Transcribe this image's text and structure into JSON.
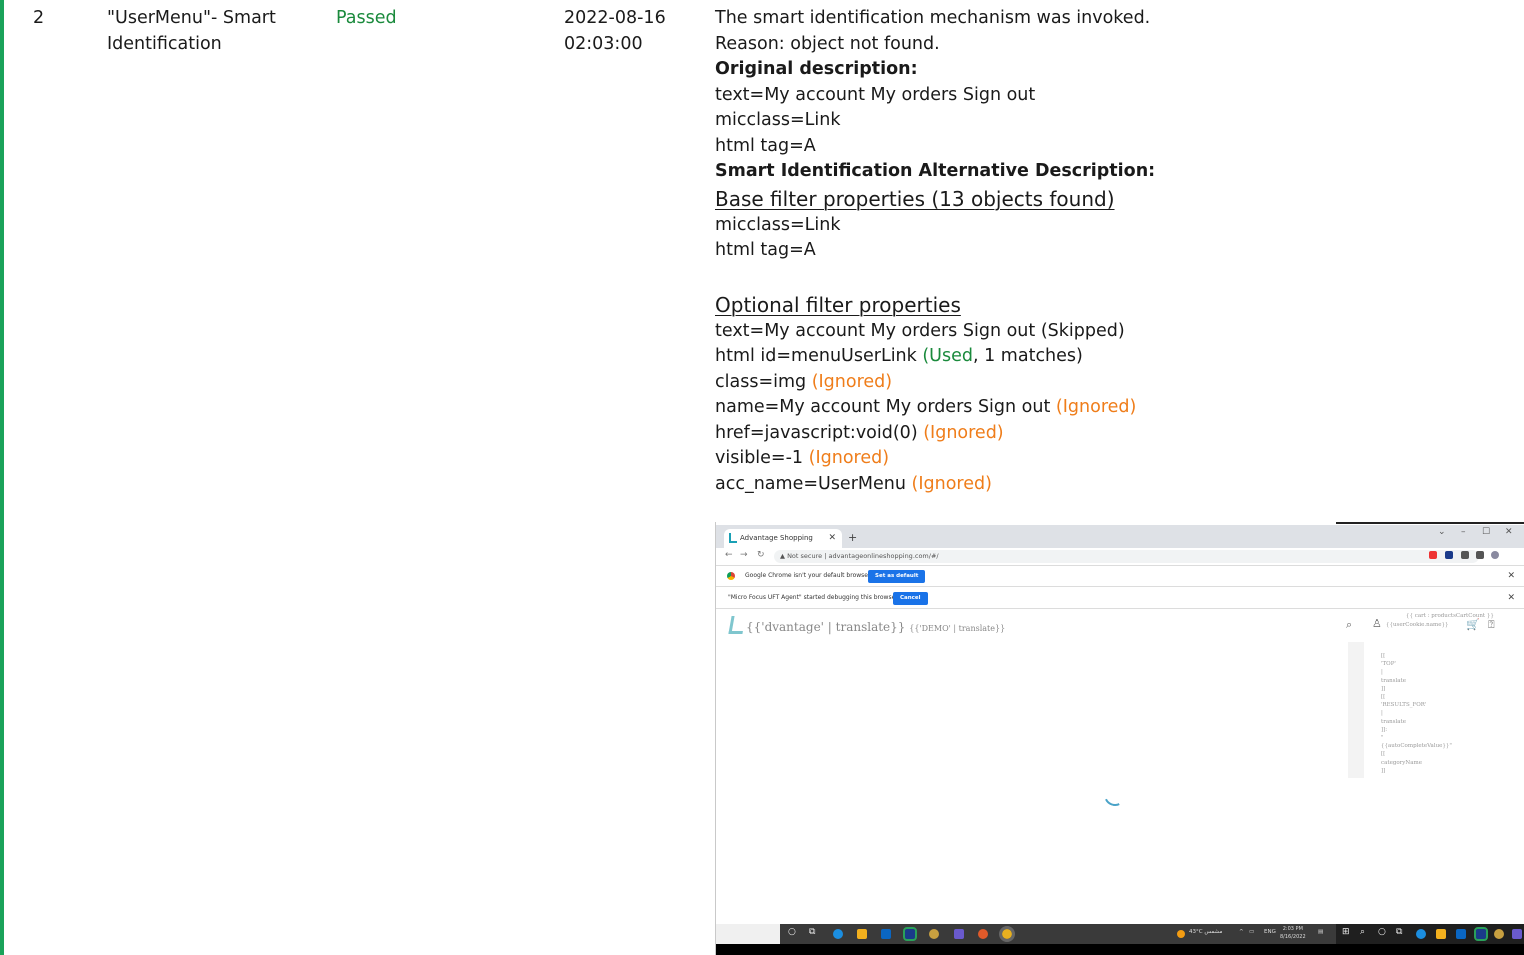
{
  "row": {
    "number": "2",
    "name_line1": "\"UserMenu\"- Smart",
    "name_line2": "Identification",
    "status": "Passed",
    "date": "2022-08-16",
    "time": "02:03:00",
    "desc": {
      "l1": "The smart identification mechanism was invoked.",
      "l2": "Reason: object not found.",
      "original_heading": "Original description:",
      "o1": "text=My account My orders Sign out",
      "o2": "micclass=Link",
      "o3": "html tag=A",
      "alt_heading": "Smart Identification Alternative Description:",
      "base_heading": "Base filter properties (13 objects found) ",
      "b1": "micclass=Link",
      "b2": "html tag=A",
      "optional_heading": "Optional filter properties",
      "p1": "text=My account My orders Sign out (Skipped)",
      "p2_a": "html id=menuUserLink ",
      "p2_used": "(Used",
      "p2_b": ", 1 matches)",
      "p3_a": "class=img ",
      "p3_tag": "(Ignored)",
      "p4_a": "name=My account My orders Sign out ",
      "p4_tag": "(Ignored)",
      "p5_a": "href=javascript:void(0) ",
      "p5_tag": "(Ignored)",
      "p6_a": "visible=-1 ",
      "p6_tag": "(Ignored)",
      "p7_a": "acc_name=UserMenu ",
      "p7_tag": "(Ignored)"
    }
  },
  "screenshot": {
    "tab_title": "Advantage Shopping",
    "tab_close": "✕",
    "tab_plus": "+",
    "url_secure": "▲ Not secure",
    "url": "advantageonlineshopping.com/#/",
    "infobar1_text": "Google Chrome isn't your default browser",
    "infobar1_button": "Set as default",
    "infobar2_text": "\"Micro Focus UFT Agent\" started debugging this browser",
    "infobar2_button": "Cancel",
    "close_glyph": "✕",
    "site_title": "{{'dvantage' | translate}}",
    "site_demo": "{{'DEMO' | translate}}",
    "cart_text": "{{ cart : productsCartCount }}",
    "user_text": "{{userCookie.name}}",
    "dropdown_text": "[[\n'TOP'\n|\ntranslate\n]]\n[[\n'RESULTS_FOR'\n|\ntranslate\n]]:\n\"\n{{autoCompleteValue}}\"\n[[\ncategoryName\n]]",
    "weather": "43°C  مشمس",
    "lang": "ENG",
    "clock_time": "2:03 PM",
    "clock_date": "8/16/2022",
    "colors": {
      "passed": "#1a8a3c",
      "ignored": "#ef7d1a",
      "accent_bar": "#1aa35a",
      "chrome_blue": "#1a73e8"
    }
  }
}
